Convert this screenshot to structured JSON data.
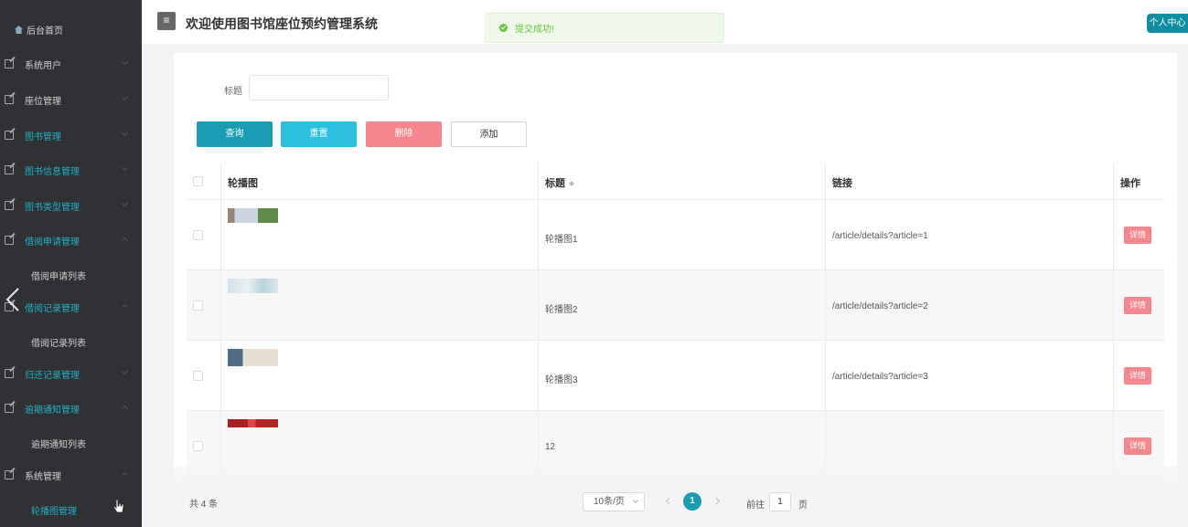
{
  "app": {
    "title": "欢迎使用图书馆座位预约管理系统",
    "profile_label": "个人中心"
  },
  "toast": {
    "message": "提交成功!"
  },
  "sidebar": {
    "home_label": "后台首页",
    "items": [
      {
        "label": "系统用户"
      },
      {
        "label": "座位管理"
      },
      {
        "label": "图书管理"
      },
      {
        "label": "图书信息管理"
      },
      {
        "label": "图书类型管理"
      },
      {
        "label": "借阅申请管理"
      },
      {
        "label": "借阅申请列表"
      },
      {
        "label": "借阅记录管理"
      },
      {
        "label": "借阅记录列表"
      },
      {
        "label": "归还记录管理"
      },
      {
        "label": "逾期通知管理"
      },
      {
        "label": "逾期通知列表"
      },
      {
        "label": "系统管理"
      },
      {
        "label": "轮播图管理"
      }
    ]
  },
  "search": {
    "label": "标题",
    "value": ""
  },
  "buttons": {
    "query": "查询",
    "reset": "重置",
    "delete": "删除",
    "add": "添加"
  },
  "table": {
    "columns": [
      "轮播图",
      "标题",
      "链接",
      "操作"
    ],
    "rows": [
      {
        "title": "轮播图1",
        "link": "/article/details?article=1",
        "action": "详情"
      },
      {
        "title": "轮播图2",
        "link": "/article/details?article=2",
        "action": "详情"
      },
      {
        "title": "轮播图3",
        "link": "/article/details?article=3",
        "action": "详情"
      },
      {
        "title": "12",
        "link": "",
        "action": "详情"
      }
    ]
  },
  "pagination": {
    "total": "共 4 条",
    "page_size": "10条/页",
    "current_page": "1",
    "goto_prefix": "前往",
    "goto_value": "1",
    "goto_suffix": "页"
  }
}
